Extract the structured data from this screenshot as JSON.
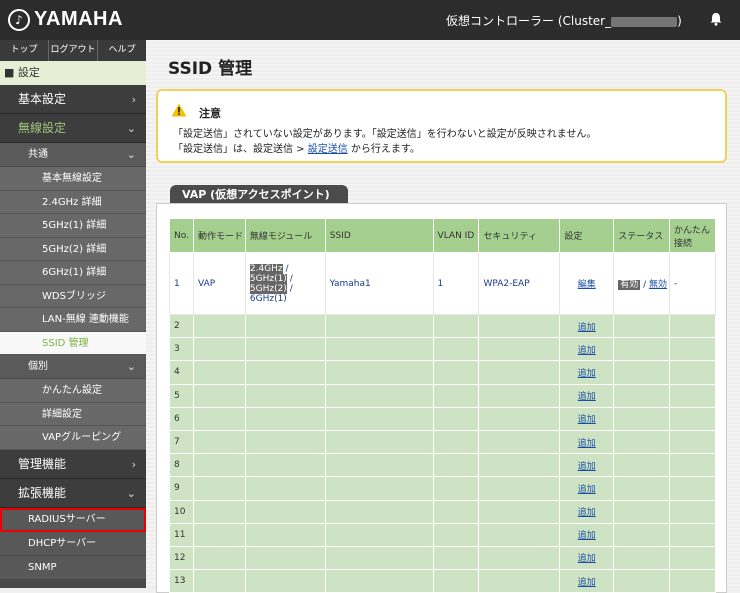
{
  "header": {
    "logo_mark": "♪",
    "logo_text": "YAMAHA",
    "title_prefix": "仮想コントローラー (Cluster_",
    "title_suffix": ")"
  },
  "sidebar": {
    "top_links": [
      "トップ",
      "ログアウト",
      "ヘルプ"
    ],
    "settings_label": "■ 設定",
    "basic": "基本設定",
    "wireless": "無線設定",
    "common": "共通",
    "common_items": [
      "基本無線設定",
      "2.4GHz 詳細",
      "5GHz(1) 詳細",
      "5GHz(2) 詳細",
      "6GHz(1) 詳細",
      "WDSブリッジ",
      "LAN-無線 連動機能",
      "SSID 管理"
    ],
    "individual": "個別",
    "individual_items": [
      "かんたん設定",
      "詳細設定",
      "VAPグルーピング"
    ],
    "management": "管理機能",
    "extended": "拡張機能",
    "extended_items": [
      "RADIUSサーバー",
      "DHCPサーバー",
      "SNMP"
    ]
  },
  "main": {
    "title": "SSID 管理",
    "notice": {
      "title": "注意",
      "line1": "「設定送信」されていない設定があります。「設定送信」を行わないと設定が反映されません。",
      "line2_prefix": "「設定送信」は、設定送信 > ",
      "line2_link": "設定送信",
      "line2_suffix": " から行えます。"
    },
    "vap_tab": "VAP (仮想アクセスポイント)",
    "columns": [
      "No.",
      "動作モード",
      "無線モジュール",
      "SSID",
      "VLAN ID",
      "セキュリティ",
      "設定",
      "ステータス",
      "かんたん接続"
    ],
    "row1": {
      "no": "1",
      "mode": "VAP",
      "modules": [
        "2.4GHz",
        "5GHz(1)",
        "5GHz(2)",
        "6GHz(1)"
      ],
      "module_sep": " /",
      "ssid": "Yamaha1",
      "vlan": "1",
      "security": "WPA2-EAP",
      "edit": "編集",
      "status_enabled": "有効",
      "status_sep": " / ",
      "status_disabled": "無効",
      "easy": "-"
    },
    "empty_rows": [
      "2",
      "3",
      "4",
      "5",
      "6",
      "7",
      "8",
      "9",
      "10",
      "11",
      "12",
      "13"
    ],
    "add_label": "追加"
  }
}
